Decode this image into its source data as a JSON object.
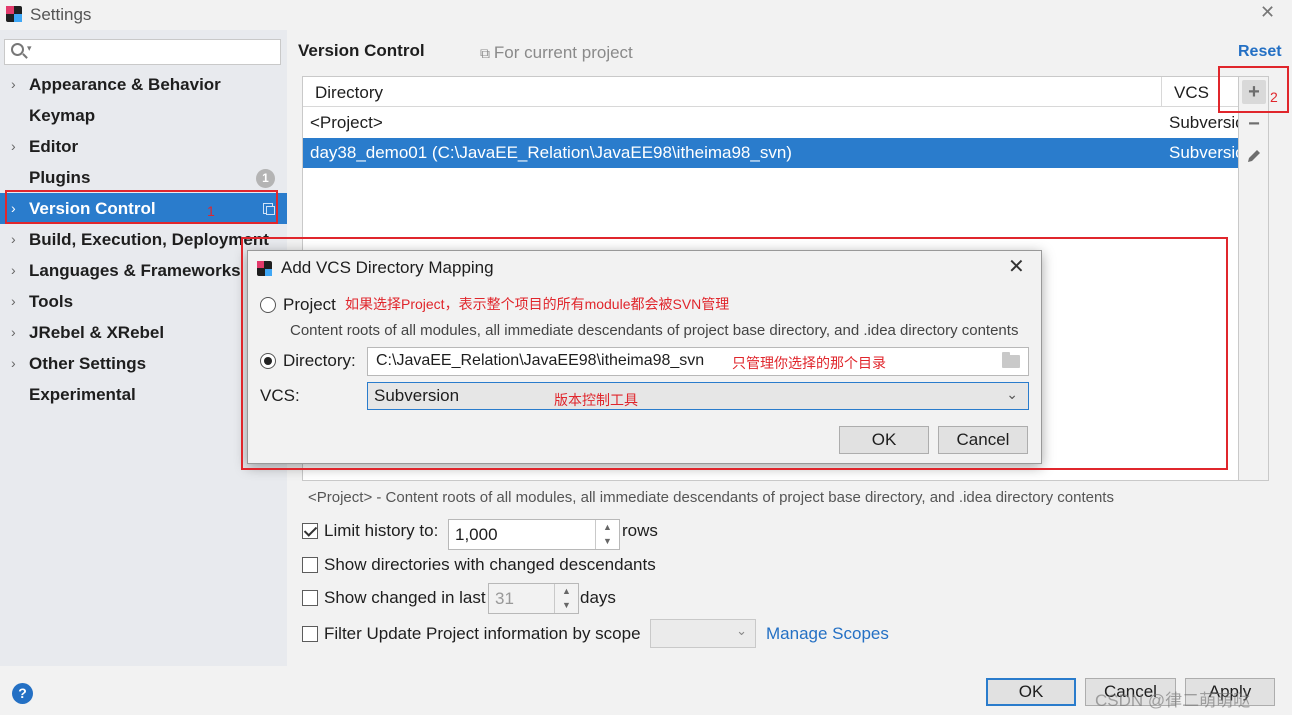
{
  "window": {
    "title": "Settings"
  },
  "sidebar": {
    "search_placeholder": "",
    "items": [
      {
        "label": "Appearance & Behavior",
        "expandable": true
      },
      {
        "label": "Keymap",
        "expandable": false
      },
      {
        "label": "Editor",
        "expandable": true
      },
      {
        "label": "Plugins",
        "expandable": false,
        "badge": "1"
      },
      {
        "label": "Version Control",
        "expandable": true,
        "selected": true
      },
      {
        "label": "Build, Execution, Deployment",
        "expandable": true
      },
      {
        "label": "Languages & Frameworks",
        "expandable": true
      },
      {
        "label": "Tools",
        "expandable": true
      },
      {
        "label": "JRebel & XRebel",
        "expandable": true
      },
      {
        "label": "Other Settings",
        "expandable": true
      },
      {
        "label": "Experimental",
        "expandable": false
      }
    ]
  },
  "main": {
    "title": "Version Control",
    "for_project": "For current project",
    "reset": "Reset",
    "table": {
      "headers": [
        "Directory",
        "VCS"
      ],
      "rows": [
        {
          "directory": "<Project>",
          "vcs": "Subversion"
        },
        {
          "directory": "day38_demo01 (C:\\JavaEE_Relation\\JavaEE98\\itheima98_svn)",
          "vcs": "Subversion",
          "selected": true
        }
      ]
    },
    "toolbar": {
      "add": "+",
      "remove": "−"
    },
    "description": "<Project> - Content roots of all modules, all immediate descendants of project base directory, and .idea directory contents",
    "options": {
      "limit_history_label": "Limit history to:",
      "limit_history_value": "1,000",
      "limit_history_suffix": "rows",
      "limit_history_checked": true,
      "show_dirs_label": "Show directories with changed descendants",
      "show_changed_label": "Show changed in last",
      "show_changed_value": "31",
      "show_changed_suffix": "days",
      "filter_label": "Filter Update Project information by scope",
      "manage_scopes": "Manage Scopes"
    }
  },
  "annotations": {
    "one": "1",
    "two": "2"
  },
  "dialog": {
    "title": "Add VCS Directory Mapping",
    "project_option": "Project",
    "project_note": "如果选择Project，表示整个项目的所有module都会被SVN管理",
    "project_desc": "Content roots of all modules, all immediate descendants of project base directory, and .idea directory contents",
    "directory_option": "Directory:",
    "directory_value": "C:\\JavaEE_Relation\\JavaEE98\\itheima98_svn",
    "directory_note": "只管理你选择的那个目录",
    "vcs_label": "VCS:",
    "vcs_value": "Subversion",
    "vcs_note": "版本控制工具",
    "ok": "OK",
    "cancel": "Cancel"
  },
  "footer": {
    "ok": "OK",
    "cancel": "Cancel",
    "apply": "Apply",
    "help": "?"
  },
  "watermark": "CSDN @律二萌萌哒",
  "colors": {
    "accent": "#2a7ccc",
    "annotation": "#e0262c",
    "link": "#2470c4"
  }
}
